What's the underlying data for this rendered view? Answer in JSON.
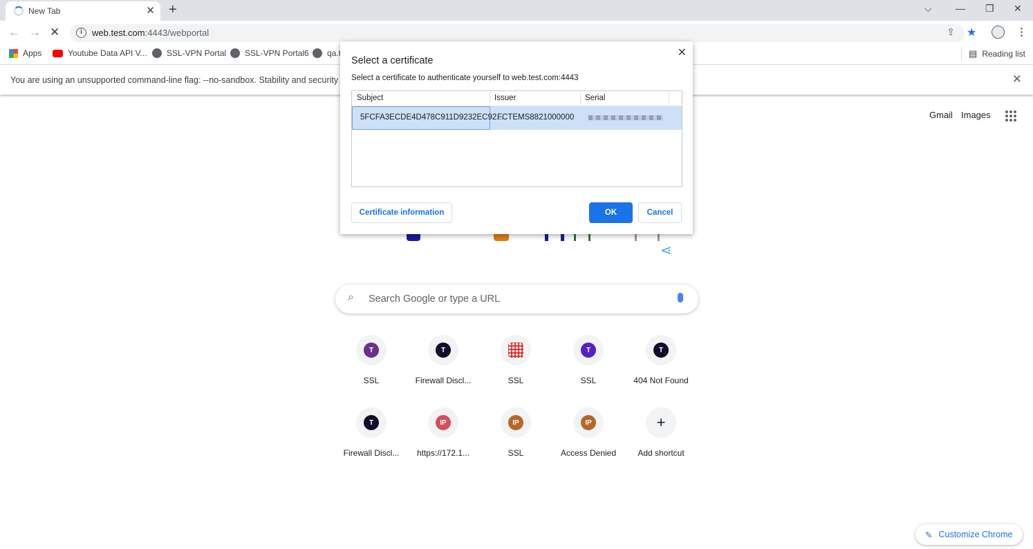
{
  "browser": {
    "tab_title": "New Tab",
    "url_host": "web.test.com",
    "url_rest": ":4443/webportal",
    "reading_list": "Reading list"
  },
  "bookmarks": [
    {
      "label": "Apps"
    },
    {
      "label": "Youtube Data API V..."
    },
    {
      "label": "SSL-VPN Portal"
    },
    {
      "label": "SSL-VPN Portal6"
    },
    {
      "label": "qa.t"
    }
  ],
  "infobar": {
    "message": "You are using an unsupported command-line flag: --no-sandbox. Stability and security wi"
  },
  "ntp": {
    "gmail": "Gmail",
    "images": "Images",
    "search_placeholder": "Search Google or type a URL",
    "customize": "Customize Chrome",
    "shortcuts": [
      {
        "letter": "T",
        "label": "SSL",
        "color": "#6b2f8c"
      },
      {
        "letter": "T",
        "label": "Firewall Discl...",
        "color": "#110c2b"
      },
      {
        "letter": "",
        "label": "SSL",
        "color": "#d8302b"
      },
      {
        "letter": "T",
        "label": "SSL",
        "color": "#5520c8"
      },
      {
        "letter": "T",
        "label": "404 Not Found",
        "color": "#110c2b"
      },
      {
        "letter": "T",
        "label": "Firewall Discl...",
        "color": "#110c2b"
      },
      {
        "letter": "IP",
        "label": "https://172.1...",
        "color": "#d44f5a"
      },
      {
        "letter": "IP",
        "label": "SSL",
        "color": "#b8652a"
      },
      {
        "letter": "IP",
        "label": "Access Denied",
        "color": "#b8652a"
      },
      {
        "letter": "+",
        "label": "Add shortcut",
        "color": ""
      }
    ]
  },
  "dialog": {
    "title": "Select a certificate",
    "subtitle": "Select a certificate to authenticate yourself to web.test.com:4443",
    "columns": [
      "Subject",
      "Issuer",
      "Serial"
    ],
    "row": {
      "subject": "5FCFA3ECDE4D478C911D9232EC92...",
      "issuer": "FCTEMS8821000000"
    },
    "cert_info": "Certificate information",
    "ok": "OK",
    "cancel": "Cancel"
  }
}
